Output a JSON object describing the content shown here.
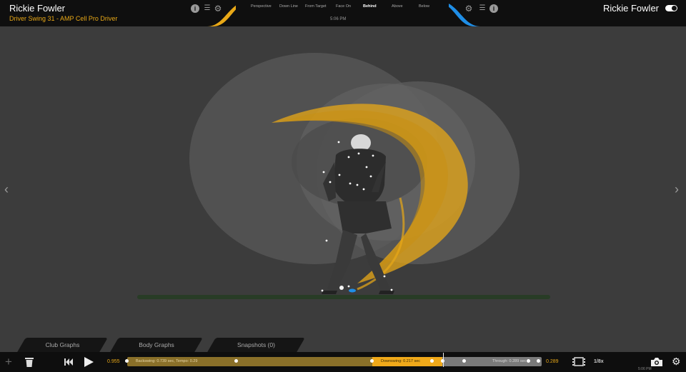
{
  "header": {
    "player_name_left": "Rickie Fowler",
    "swing_title": "Driver Swing 31 - AMP Cell Pro Driver",
    "player_name_right": "Rickie Fowler",
    "time": "5:06 PM",
    "views": [
      "Perspective",
      "Down Line",
      "From Target",
      "Face On",
      "Behind",
      "Above",
      "Below"
    ],
    "active_view": "Behind",
    "accent_gold": "#e8a817",
    "accent_blue": "#1f8ee6"
  },
  "stage": {
    "nav_left": "‹",
    "nav_right": "›"
  },
  "panels": {
    "tabs": [
      "Club Graphs",
      "Body Graphs",
      "Snapshots (0)"
    ]
  },
  "timeline": {
    "start_value": "0.955",
    "end_value": "0.289",
    "backswing_label": "Backswing: 0.739 sec, Tempo: 0.29",
    "downswing_label": "Downswing: 0.217 sec",
    "through_label": "Through: 0.289 sec",
    "speed": "1/8x",
    "time": "5:06 PM"
  }
}
